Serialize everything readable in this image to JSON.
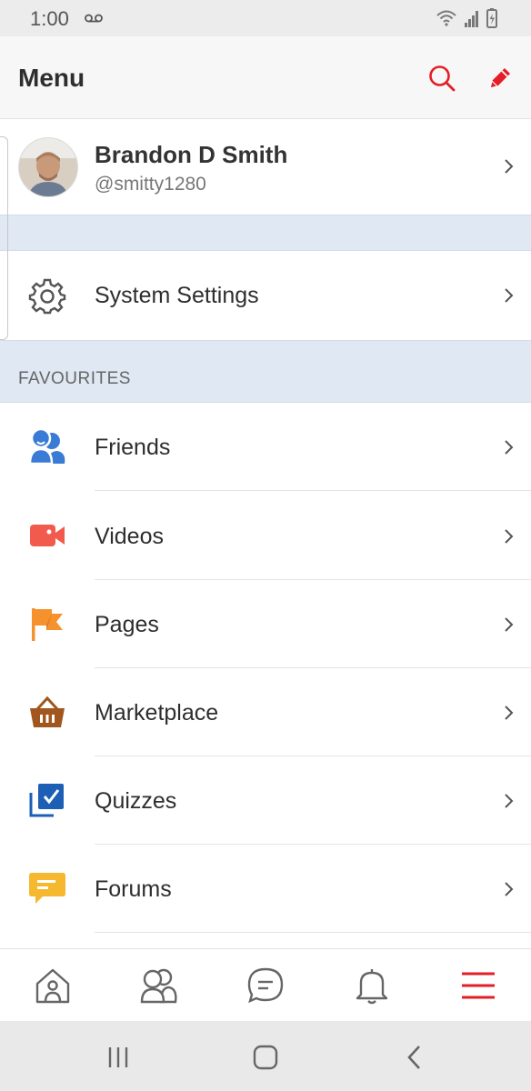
{
  "status_bar": {
    "time": "1:00"
  },
  "header": {
    "title": "Menu",
    "search_icon": "search-icon",
    "compose_icon": "pencil-icon",
    "accent_color": "#e41e26"
  },
  "profile": {
    "name": "Brandon D Smith",
    "handle": "@smitty1280"
  },
  "system": {
    "label": "System Settings",
    "icon": "gear-icon"
  },
  "favourites": {
    "header": "FAVOURITES",
    "items": [
      {
        "label": "Friends",
        "icon": "friends-icon",
        "color": "#3a7bd5"
      },
      {
        "label": "Videos",
        "icon": "video-camera-icon",
        "color": "#f25a4e"
      },
      {
        "label": "Pages",
        "icon": "flag-icon",
        "color": "#f5922d"
      },
      {
        "label": "Marketplace",
        "icon": "basket-icon",
        "color": "#a0561c"
      },
      {
        "label": "Quizzes",
        "icon": "quiz-checkbox-icon",
        "color": "#1d5fb4"
      },
      {
        "label": "Forums",
        "icon": "forum-chat-icon",
        "color": "#f5b82e"
      }
    ]
  },
  "bottom_nav": [
    "home-icon",
    "friends-icon",
    "chat-icon",
    "bell-icon",
    "menu-icon"
  ],
  "colors": {
    "band": "#dfe8f3",
    "accent": "#e41e26"
  }
}
